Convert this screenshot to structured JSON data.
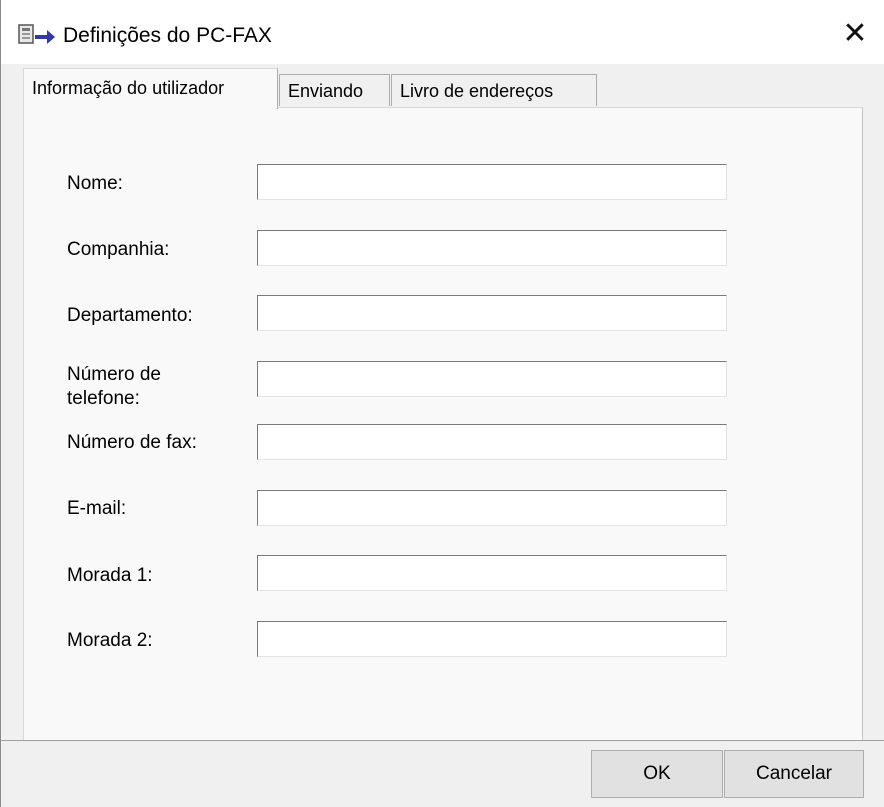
{
  "window": {
    "title": "Definições do PC-FAX",
    "close_symbol": "✕",
    "icon": "pc-fax-icon"
  },
  "tabs": [
    {
      "label": "Informação do utilizador",
      "active": true
    },
    {
      "label": "Enviando",
      "active": false
    },
    {
      "label": "Livro de endereços",
      "active": false
    }
  ],
  "fields": {
    "nome": {
      "label": "Nome:",
      "value": ""
    },
    "companhia": {
      "label": "Companhia:",
      "value": ""
    },
    "departamento": {
      "label": "Departamento:",
      "value": ""
    },
    "telefone": {
      "label": "Número de telefone:",
      "value": ""
    },
    "fax": {
      "label": "Número de fax:",
      "value": ""
    },
    "email": {
      "label": "E-mail:",
      "value": ""
    },
    "morada1": {
      "label": "Morada 1:",
      "value": ""
    },
    "morada2": {
      "label": "Morada 2:",
      "value": ""
    }
  },
  "buttons": {
    "ok": "OK",
    "cancel": "Cancelar"
  }
}
